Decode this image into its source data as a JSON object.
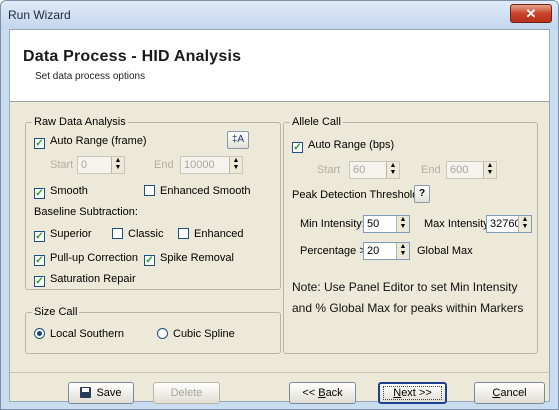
{
  "window": {
    "title": "Run Wizard",
    "close_glyph": "✕"
  },
  "header": {
    "title": "Data Process - HID Analysis",
    "subtitle": "Set data process options"
  },
  "raw_data": {
    "legend": "Raw Data Analysis",
    "auto_range_label": "Auto Range (frame)",
    "auto_range_checked": true,
    "range_tool_glyph": "‡A",
    "start_label": "Start",
    "start_value": "0",
    "end_label": "End",
    "end_value": "10000",
    "smooth_label": "Smooth",
    "smooth_checked": true,
    "enhanced_smooth_label": "Enhanced Smooth",
    "enhanced_smooth_checked": false,
    "baseline_label": "Baseline Subtraction:",
    "superior_label": "Superior",
    "superior_checked": true,
    "classic_label": "Classic",
    "classic_checked": false,
    "enhanced_label": "Enhanced",
    "enhanced_checked": false,
    "pullup_label": "Pull-up Correction",
    "pullup_checked": true,
    "spike_label": "Spike Removal",
    "spike_checked": true,
    "saturation_label": "Saturation Repair",
    "saturation_checked": true
  },
  "size_call": {
    "legend": "Size Call",
    "local_southern_label": "Local Southern",
    "cubic_spline_label": "Cubic Spline",
    "selected": "Local Southern"
  },
  "allele_call": {
    "legend": "Allele Call",
    "auto_range_label": "Auto Range (bps)",
    "auto_range_checked": true,
    "start_label": "Start",
    "start_value": "60",
    "end_label": "End",
    "end_value": "600",
    "peak_threshold_label": "Peak Detection Threshold:",
    "help_glyph": "?",
    "min_intensity_label": "Min Intensity:",
    "min_intensity_value": "50",
    "max_intensity_label": "Max Intensity:",
    "max_intensity_value": "32760",
    "percentage_label": "Percentage >",
    "percentage_value": "20",
    "global_max_label": "Global Max",
    "note": "Note: Use Panel Editor to set Min Intensity and % Global Max for peaks within Markers"
  },
  "buttons": {
    "save": "Save",
    "delete": "Delete",
    "back_prefix": "<< ",
    "back_key": "B",
    "back_rest": "ack",
    "next_key": "N",
    "next_rest": "ext >>",
    "cancel_key": "C",
    "cancel_rest": "ancel"
  },
  "colors": {
    "check_mark": "#21a121",
    "title_bar": "#c4d7ee",
    "close_button": "#c9432b"
  }
}
